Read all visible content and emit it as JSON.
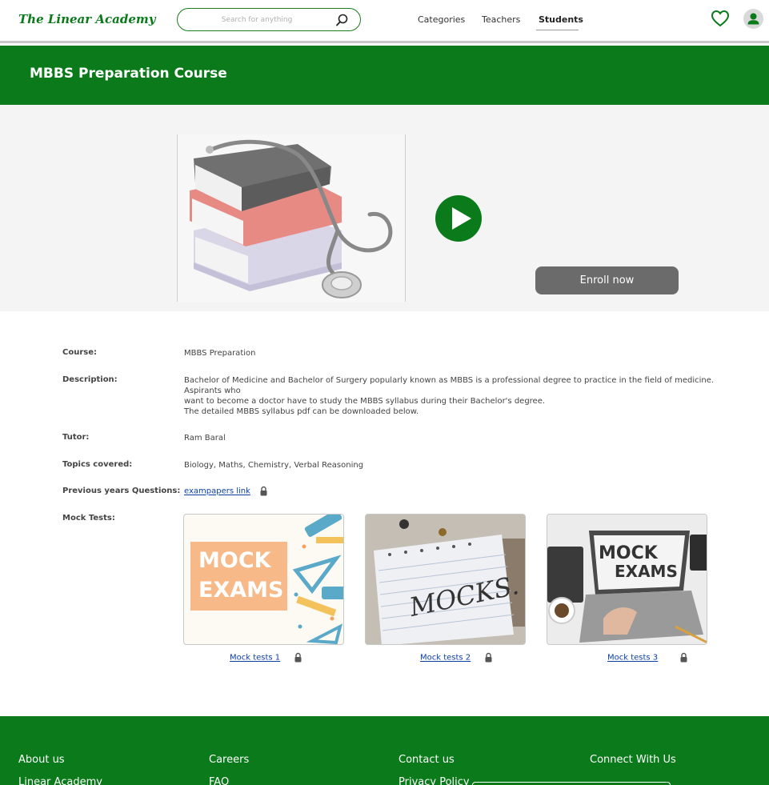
{
  "header": {
    "logo": "The Linear Academy",
    "search_placeholder": "Search for anything",
    "nav": [
      "Categories",
      "Teachers",
      "Students"
    ],
    "active_nav": "Students"
  },
  "page": {
    "title": "MBBS Preparation Course"
  },
  "hero": {
    "enroll_label": "Enroll now"
  },
  "details": {
    "course_label": "Course:",
    "course_value": "MBBS Preparation",
    "description_label": "Description:",
    "description_lines": [
      "Bachelor of Medicine and Bachelor of Surgery popularly known as MBBS is a professional degree to practice in the field of medicine.",
      "Aspirants  who",
      "want to become a doctor have to study the MBBS syllabus during their Bachelor's degree.",
      "The detailed MBBS syllabus pdf can be downloaded below."
    ],
    "tutor_label": "Tutor:",
    "tutor_value": "Ram Baral",
    "topics_label": "Topics covered:",
    "topics_value": "Biology, Maths, Chemistry, Verbal Reasoning",
    "pyq_label": "Previous years Questions:",
    "pyq_link": "exampapers link",
    "mock_label": "Mock Tests:"
  },
  "mocks": [
    {
      "image_text": [
        "MOCK",
        "EXAMS"
      ],
      "link": "Mock tests 1"
    },
    {
      "image_text": [
        "MOCKS."
      ],
      "link": "Mock tests 2"
    },
    {
      "image_text": [
        "MOCK",
        "EXAMS"
      ],
      "link": "Mock tests 3"
    }
  ],
  "footer": {
    "columns": [
      {
        "heading": "About us",
        "item": "Linear Academy"
      },
      {
        "heading": "Careers",
        "item": "FAQ"
      },
      {
        "heading": "Contact us",
        "item": "Privacy Policy"
      },
      {
        "heading": "Connect With Us",
        "item": ""
      }
    ]
  },
  "colors": {
    "brand_green": "#0a7a1a",
    "enroll_gray": "#6b6b6b",
    "link_blue": "#0b3fa8"
  },
  "icons": [
    "search-icon",
    "heart-icon",
    "user-icon",
    "play-icon",
    "lock-icon"
  ]
}
